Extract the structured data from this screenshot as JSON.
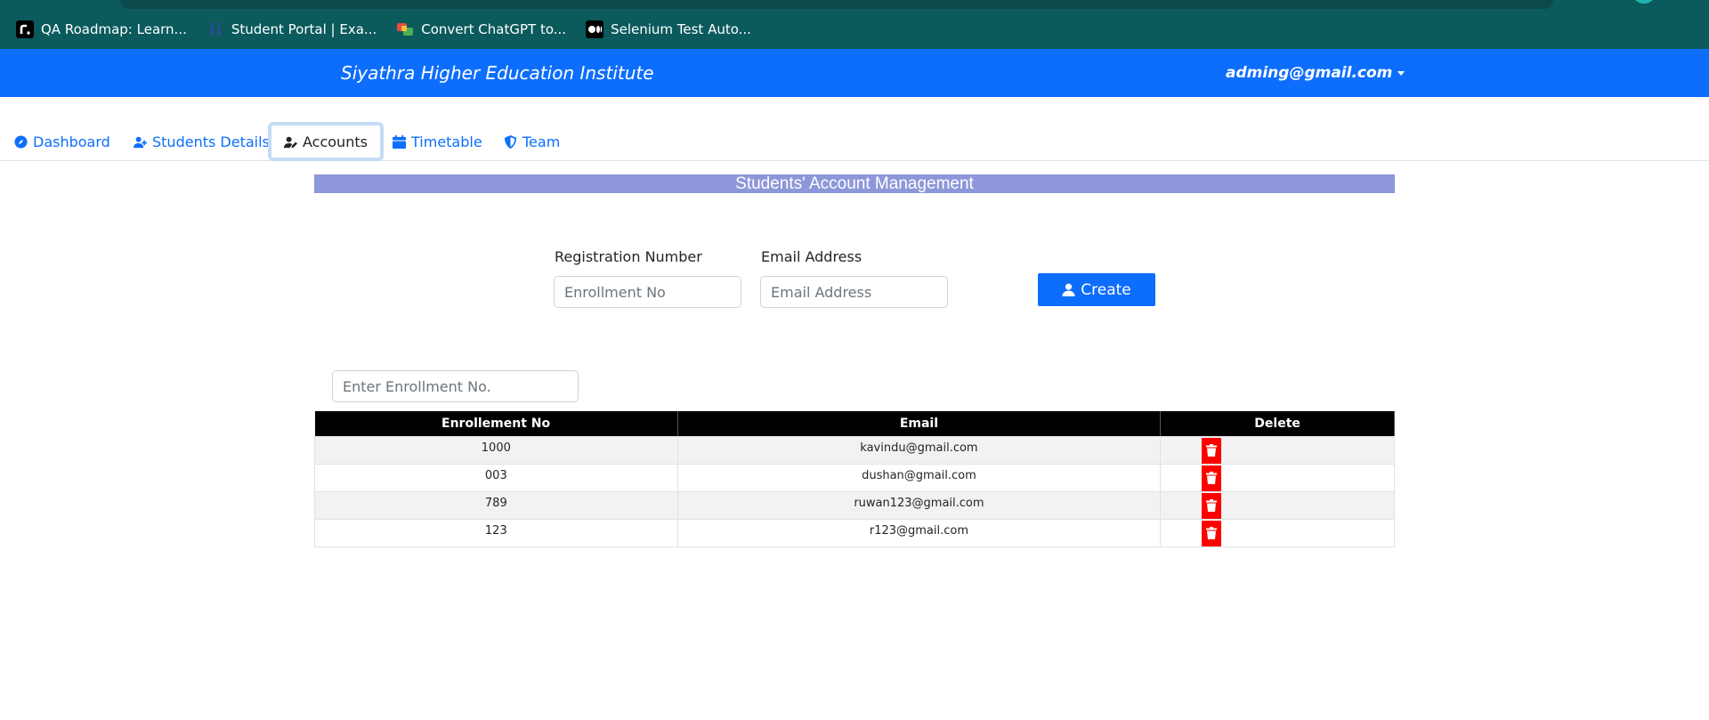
{
  "bookmarks": [
    {
      "label": "QA Roadmap: Learn...",
      "icon": "roadmap-r-icon"
    },
    {
      "label": "Student Portal | Exa...",
      "icon": "student-portal-icon"
    },
    {
      "label": "Convert ChatGPT to...",
      "icon": "convert-icon"
    },
    {
      "label": "Selenium Test Auto...",
      "icon": "medium-icon"
    }
  ],
  "header": {
    "brand": "Siyathra Higher Education Institute",
    "user_email": "adming@gmail.com"
  },
  "tabs": [
    {
      "label": "Dashboard",
      "icon": "compass-icon",
      "active": false
    },
    {
      "label": "Students Details",
      "icon": "user-plus-icon",
      "active": false
    },
    {
      "label": "Accounts",
      "icon": "user-edit-icon",
      "active": true
    },
    {
      "label": "Timetable",
      "icon": "calendar-icon",
      "active": false
    },
    {
      "label": "Team",
      "icon": "shield-icon",
      "active": false
    }
  ],
  "section_title": "Students' Account Management",
  "form": {
    "reg_label": "Registration Number",
    "reg_placeholder": "Enrollment No",
    "email_label": "Email Address",
    "email_placeholder": "Email Address",
    "create_label": "Create"
  },
  "search": {
    "placeholder": "Enter Enrollment No."
  },
  "table": {
    "headers": [
      "Enrollement No",
      "Email",
      "Delete"
    ],
    "rows": [
      {
        "enrollment": "1000",
        "email": "kavindu@gmail.com"
      },
      {
        "enrollment": "003",
        "email": "dushan@gmail.com"
      },
      {
        "enrollment": "789",
        "email": "ruwan123@gmail.com"
      },
      {
        "enrollment": "123",
        "email": "r123@gmail.com"
      }
    ]
  },
  "colors": {
    "header_blue": "#0d6efd",
    "browser_teal": "#0b5a5c",
    "section_bar": "#8d97d9",
    "delete_red": "#ff0000"
  }
}
